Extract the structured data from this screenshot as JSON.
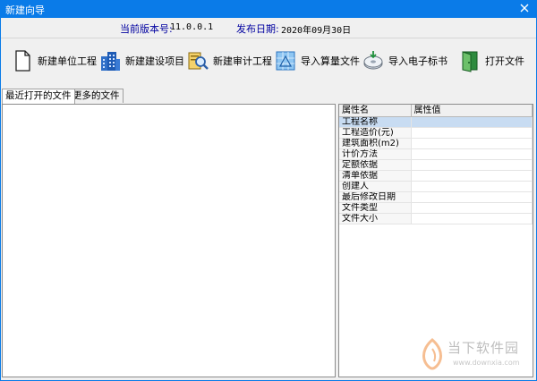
{
  "window": {
    "title": "新建向导"
  },
  "info": {
    "version_label": "当前版本号:",
    "version_value": "11.0.0.1",
    "date_label": "发布日期:",
    "date_value": "2020年09月30日"
  },
  "toolbar": {
    "new_unit": "新建单位工程",
    "new_project": "新建建设项目",
    "new_audit": "新建审计工程",
    "import_calc": "导入算量文件",
    "import_bid": "导入电子标书",
    "open_file": "打开文件"
  },
  "tabs": {
    "recent": "最近打开的文件",
    "more": "更多的文件"
  },
  "properties": {
    "header_name": "属性名",
    "header_value": "属性值",
    "rows": [
      {
        "name": "工程名称",
        "value": ""
      },
      {
        "name": "工程造价(元)",
        "value": ""
      },
      {
        "name": "建筑面积(m2)",
        "value": ""
      },
      {
        "name": "计价方法",
        "value": ""
      },
      {
        "name": "定额依据",
        "value": ""
      },
      {
        "name": "清单依据",
        "value": ""
      },
      {
        "name": "创建人",
        "value": ""
      },
      {
        "name": "最后修改日期",
        "value": ""
      },
      {
        "name": "文件类型",
        "value": ""
      },
      {
        "name": "文件大小",
        "value": ""
      }
    ]
  },
  "watermark": {
    "name": "当下软件园",
    "url": "www.downxia.com"
  },
  "colors": {
    "titlebar": "#0a7be8",
    "selected_row": "#c8dcf2",
    "info_label": "#0000a0"
  }
}
